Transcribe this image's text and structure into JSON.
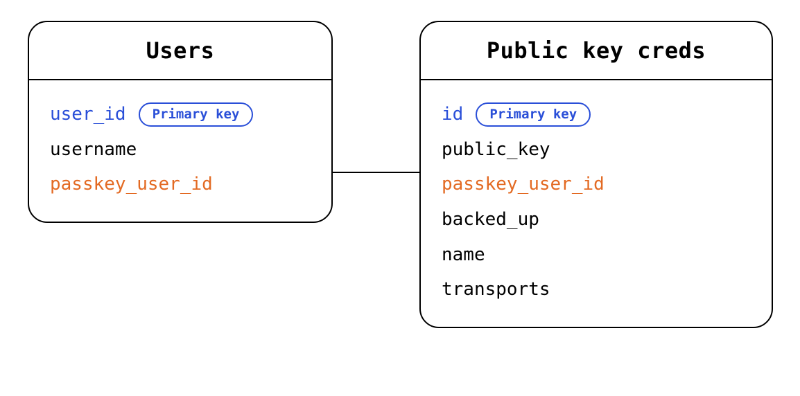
{
  "entities": {
    "users": {
      "title": "Users",
      "fields": {
        "f0": {
          "name": "user_id",
          "pill": "Primary key"
        },
        "f1": {
          "name": "username"
        },
        "f2": {
          "name": "passkey_user_id"
        }
      }
    },
    "creds": {
      "title": "Public key creds",
      "fields": {
        "f0": {
          "name": "id",
          "pill": "Primary key"
        },
        "f1": {
          "name": "public_key"
        },
        "f2": {
          "name": "passkey_user_id"
        },
        "f3": {
          "name": "backed_up"
        },
        "f4": {
          "name": "name"
        },
        "f5": {
          "name": "transports"
        }
      }
    }
  },
  "colors": {
    "primary_key": "#2a4fd8",
    "foreign_key": "#e36a23",
    "border": "#000000"
  }
}
